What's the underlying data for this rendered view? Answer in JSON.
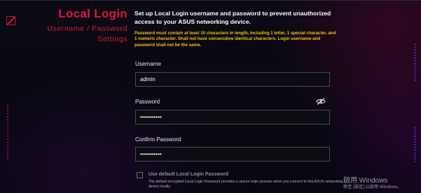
{
  "header": {
    "title": "Local Login",
    "subtitle_line1": "Username / Password",
    "subtitle_line2": "Settings"
  },
  "intro": "Set up Local Login username and password to prevent unauthorized access to your ASUS networking device.",
  "warning": "Password must contain at least 10 characters in length, including 1 letter, 1 special character, and 1 numeric character. Shall not have consecutive identical characters. Login username and password shall not be the same.",
  "form": {
    "username_label": "Username",
    "username_value": "admin",
    "password_label": "Password",
    "password_value": "•••••••••••",
    "confirm_label": "Confirm Password",
    "confirm_value": "•••••••••••",
    "toggle_icon": "eye-slash-icon"
  },
  "default_option": {
    "label": "Use default Local Login Password",
    "description": "The default encrypted Local Login Password provides a secure login process when you connect to this ASUS networking device locally.",
    "checked": false
  },
  "watermark": {
    "line1": "啟用 Windows",
    "line2": "移至 [設定] 以啟用 Windows。"
  },
  "colors": {
    "accent": "#e0143c",
    "warning": "#f4c20d",
    "background": "#08080f"
  }
}
